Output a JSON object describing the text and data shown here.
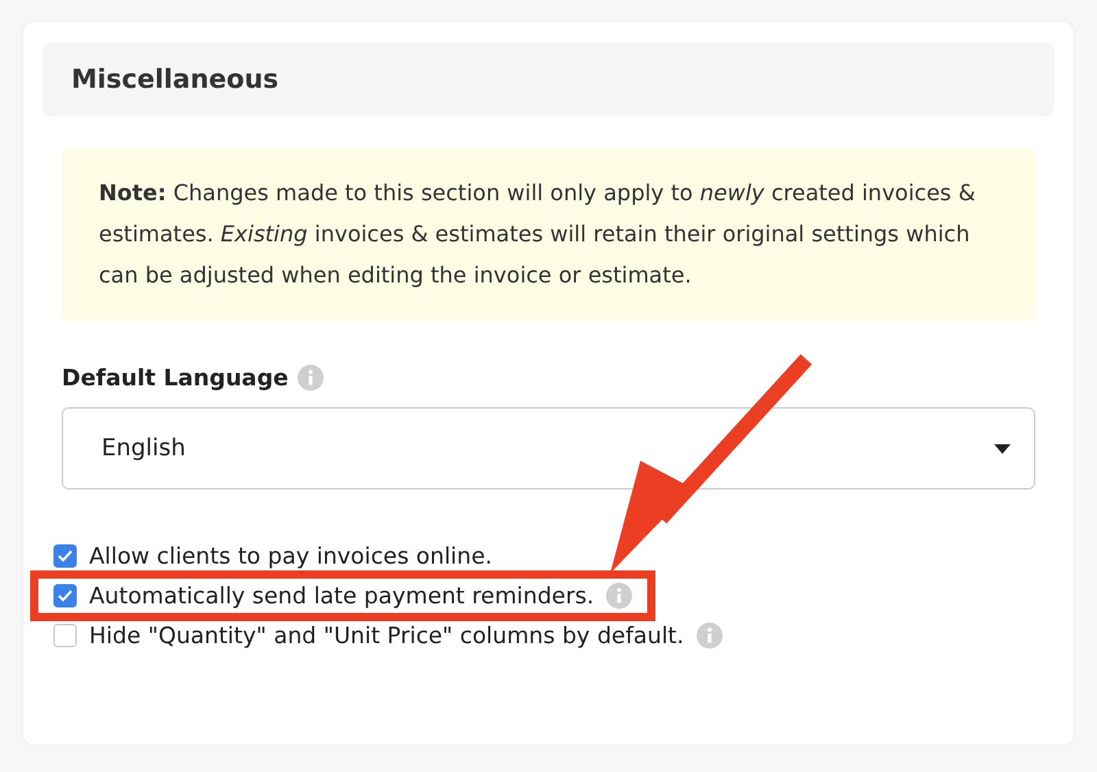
{
  "section": {
    "title": "Miscellaneous"
  },
  "note": "**Note:** Changes made to this section will only apply to *newly* created invoices & estimates. *Existing* invoices & estimates will retain their original settings which can be adjusted when editing the invoice or estimate.",
  "language": {
    "label": "Default Language",
    "value": "English"
  },
  "options": [
    {
      "label": "Allow clients to pay invoices online.",
      "checked": true,
      "info": false,
      "highlighted": false
    },
    {
      "label": "Automatically send late payment reminders.",
      "checked": true,
      "info": true,
      "highlighted": true
    },
    {
      "label": "Hide \"Quantity\" and \"Unit Price\" columns by default.",
      "checked": false,
      "info": true,
      "highlighted": false
    }
  ]
}
